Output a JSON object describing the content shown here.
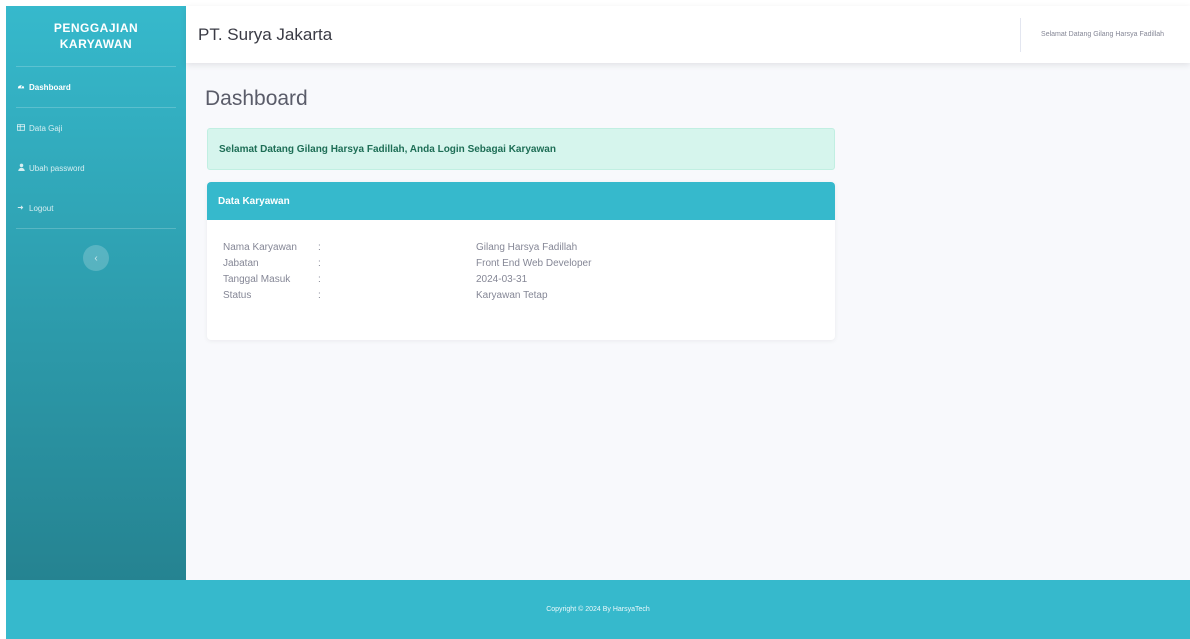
{
  "sidebar": {
    "brand_line1": "PENGGAJIAN",
    "brand_line2": "KARYAWAN",
    "items": [
      {
        "label": "Dashboard",
        "icon": "tachometer-icon"
      },
      {
        "label": "Data Gaji",
        "icon": "table-icon"
      },
      {
        "label": "Ubah password",
        "icon": "user-icon"
      },
      {
        "label": "Logout",
        "icon": "logout-icon"
      }
    ],
    "toggle_glyph": "‹"
  },
  "topbar": {
    "company": "PT. Surya Jakarta",
    "welcome": "Selamat Datang Gilang Harsya Fadillah"
  },
  "main": {
    "title": "Dashboard",
    "alert": "Selamat Datang Gilang Harsya Fadillah, Anda Login Sebagai Karyawan",
    "card": {
      "header": "Data Karyawan",
      "rows": [
        {
          "label": "Nama Karyawan",
          "colon": ":",
          "value": "Gilang Harsya Fadillah"
        },
        {
          "label": "Jabatan",
          "colon": ":",
          "value": "Front End Web Developer"
        },
        {
          "label": "Tanggal Masuk",
          "colon": ":",
          "value": "2024-03-31"
        },
        {
          "label": "Status",
          "colon": ":",
          "value": "Karyawan Tetap"
        }
      ]
    }
  },
  "footer": {
    "text": "Copyright © 2024 By HarsyaTech"
  },
  "colors": {
    "accent": "#36b9cc",
    "accent_dark": "#258391",
    "alert_bg": "#d6f5ed",
    "alert_text": "#1e6e56"
  }
}
